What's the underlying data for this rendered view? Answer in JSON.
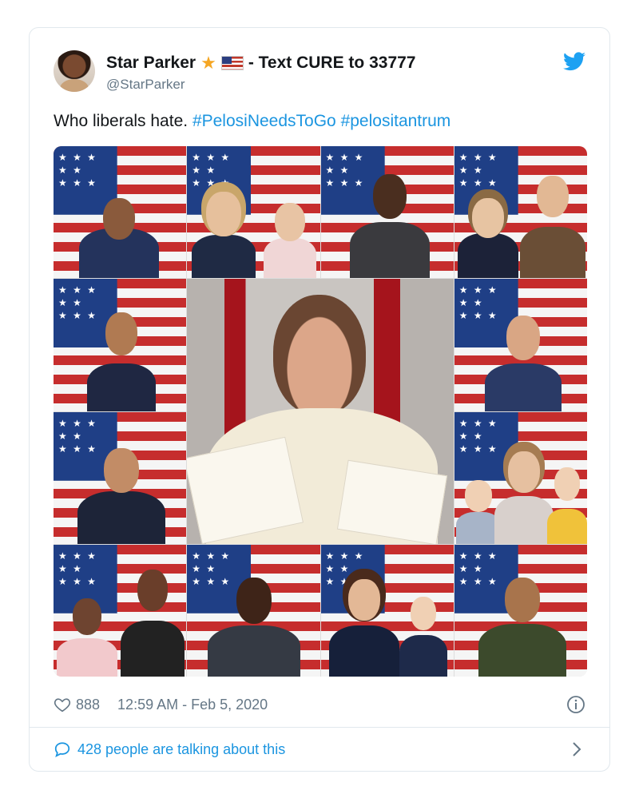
{
  "tweet": {
    "author": {
      "display_name": "Star Parker",
      "name_suffix": "- Text CURE to 33777",
      "handle": "@StarParker"
    },
    "text": "Who liberals hate.",
    "hashtags": [
      "#PelosiNeedsToGo",
      "#pelositantrum"
    ],
    "likes": "888",
    "timestamp": "12:59 AM - Feb 5, 2020",
    "talking": "428 people are talking about this"
  },
  "icons": {
    "brand": "twitter-bird-icon",
    "like": "heart-icon",
    "info": "info-icon",
    "conversation": "comment-icon",
    "more": "chevron-right-icon"
  },
  "colors": {
    "link": "#1b95e0",
    "muted": "#657786",
    "border": "#e1e8ed",
    "twitter_blue": "#1da1f2"
  }
}
